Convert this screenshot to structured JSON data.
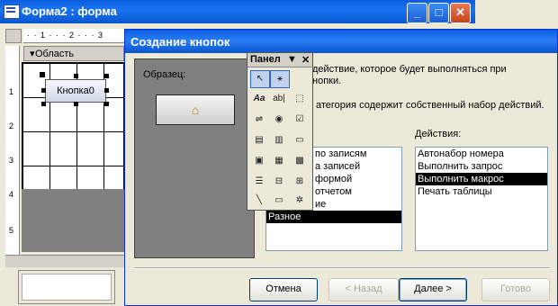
{
  "form_window": {
    "title": "Форма2 : форма",
    "ruler_text": "· · 1 · · · 2 · · · 3",
    "section_label": "Область данных",
    "vruler": [
      "1",
      "2",
      "3",
      "4",
      "5"
    ],
    "button_control_label": "Кнопка0"
  },
  "wizard": {
    "title": "Создание кнопок",
    "preview_label": "Образец:",
    "preview_button_glyph": "⌂",
    "description_line1": "действие, которое будет выполняться при",
    "description_line1b": "нопки.",
    "description_line2": "атегория содержит собственный набор действий.",
    "categories_label": ":",
    "actions_label": "Действия:",
    "categories": [
      "по записям",
      "а записей",
      "формой",
      "отчетом",
      "ие",
      "Разное"
    ],
    "categories_selected_index": 5,
    "actions": [
      "Автонабор номера",
      "Выполнить запрос",
      "Выполнить макрос",
      "Печать таблицы"
    ],
    "actions_selected_index": 2,
    "buttons": {
      "cancel": "Отмена",
      "back": "< Назад",
      "next": "Далее >",
      "finish": "Готово"
    }
  },
  "toolbox": {
    "title": "Панел",
    "dropdown_glyph": "▼",
    "close_glyph": "✕",
    "tools": [
      "select-arrow",
      "wizard-wand",
      "label-Aa",
      "textbox-ab",
      "option-group",
      "toggle-button",
      "option-button",
      "check-box",
      "combo-box",
      "list-box",
      "command-button",
      "image",
      "unbound-frame",
      "bound-frame",
      "page-break",
      "tab-control",
      "subform",
      "line",
      "rectangle",
      "more-tools"
    ]
  }
}
